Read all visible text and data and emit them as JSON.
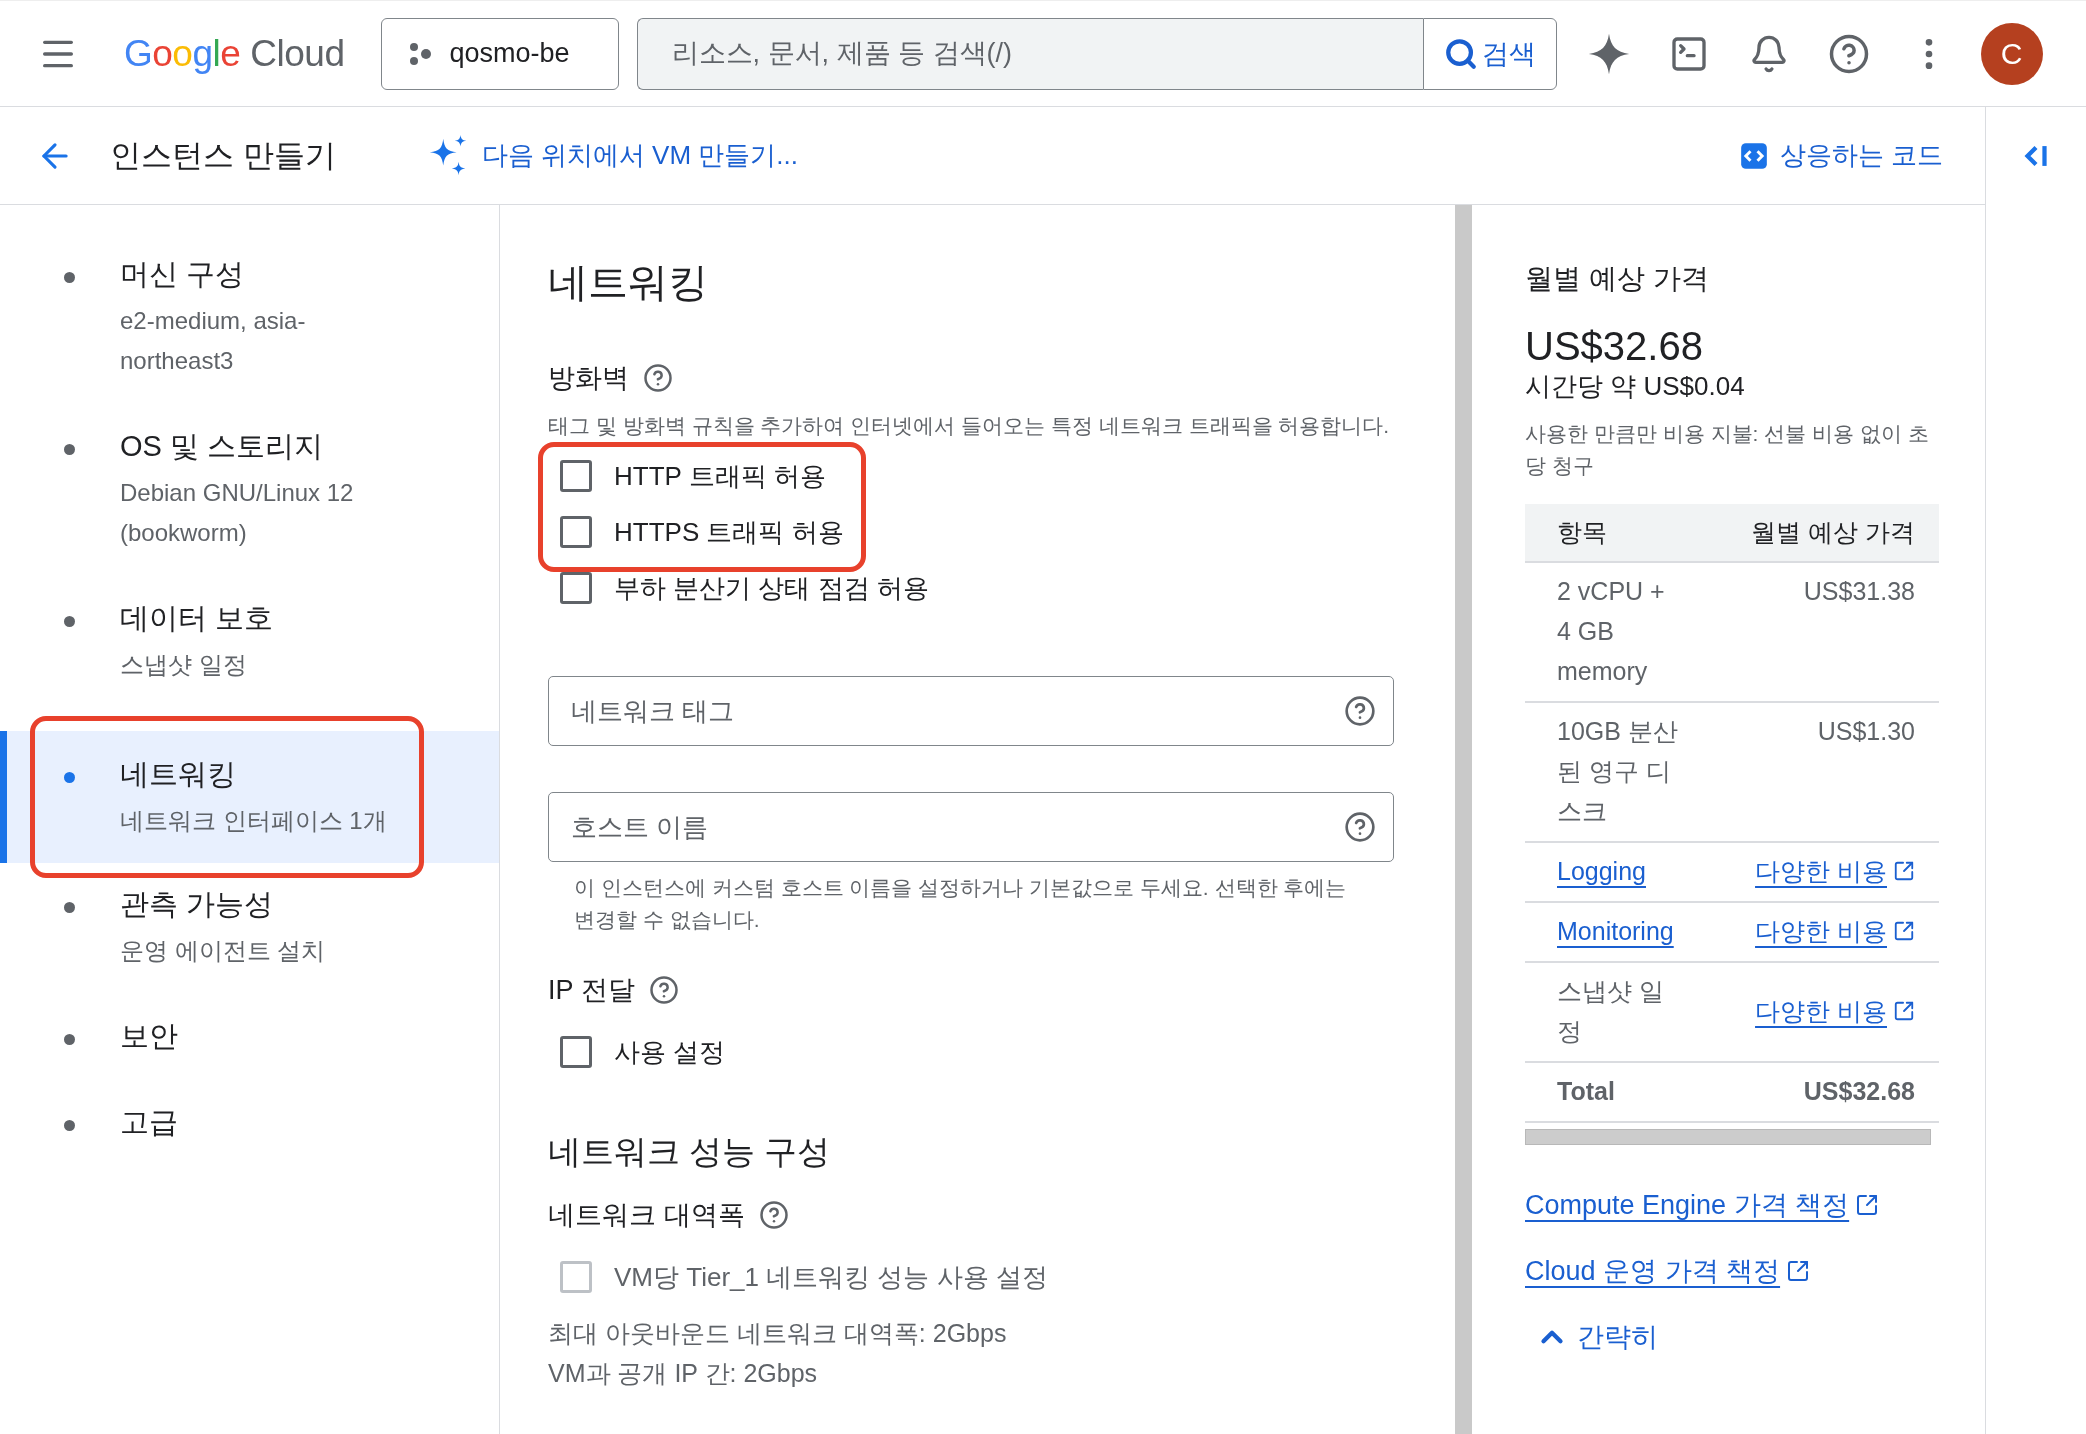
{
  "top_bar": {
    "logo": {
      "word_1": "Google",
      "word_2": "Cloud"
    },
    "project": "qosmo-be",
    "search": {
      "placeholder": "리소스, 문서, 제품 등 검색(/)",
      "button": "검색"
    },
    "avatar": "C"
  },
  "page_header": {
    "title": "인스턴스 만들기",
    "ai_link": "다음 위치에서 VM 만들기...",
    "code_link": "상응하는 코드"
  },
  "sidebar": {
    "items": [
      {
        "title": "머신 구성",
        "subtitle": "e2-medium, asia-northeast3",
        "selected": false,
        "highlighted": false
      },
      {
        "title": "OS 및 스토리지",
        "subtitle": "Debian GNU/Linux 12 (bookworm)",
        "selected": false,
        "highlighted": false
      },
      {
        "title": "데이터 보호",
        "subtitle": "스냅샷 일정",
        "selected": false,
        "highlighted": false
      },
      {
        "title": "네트워킹",
        "subtitle": "네트워크 인터페이스 1개",
        "selected": true,
        "highlighted": true
      },
      {
        "title": "관측 가능성",
        "subtitle": "운영 에이전트 설치",
        "selected": false,
        "highlighted": false
      },
      {
        "title": "보안",
        "selected": false,
        "highlighted": false
      },
      {
        "title": "고급",
        "selected": false,
        "highlighted": false
      }
    ]
  },
  "form": {
    "title": "네트워킹",
    "firewall": {
      "label": "방화벽",
      "description": "태그 및 방화벽 규칙을 추가하여 인터넷에서 들어오는 특정 네트워크 트래픽을 허용합니다.",
      "options": [
        {
          "label": "HTTP 트래픽 허용",
          "checked": false,
          "highlighted": true
        },
        {
          "label": "HTTPS 트래픽 허용",
          "checked": false,
          "highlighted": true
        },
        {
          "label": "부하 분산기 상태 점검 허용",
          "checked": false,
          "highlighted": false
        }
      ]
    },
    "network_tags": {
      "placeholder": "네트워크 태그"
    },
    "hostname": {
      "placeholder": "호스트 이름",
      "helper": "이 인스턴스에 커스텀 호스트 이름을 설정하거나 기본값으로 두세요. 선택한 후에는 변경할 수 없습니다."
    },
    "ip_forwarding": {
      "label": "IP 전달",
      "options": [
        {
          "label": "사용 설정",
          "checked": false
        }
      ]
    },
    "performance": {
      "title": "네트워크 성능 구성",
      "bandwidth_label": "네트워크 대역폭",
      "options": [
        {
          "label": "VM당 Tier_1 네트워킹 성능 사용 설정",
          "checked": false,
          "disabled": true
        }
      ],
      "info": [
        "최대 아웃바운드 네트워크 대역폭: 2Gbps",
        "VM과 공개 IP 간: 2Gbps"
      ]
    }
  },
  "pricing": {
    "title": "월별 예상 가격",
    "total": "US$32.68",
    "hourly": "시간당 약 US$0.04",
    "note": "사용한 만큼만 비용 지불: 선불 비용 없이 초당 청구",
    "columns": [
      "항목",
      "월별 예상 가격"
    ],
    "rows": [
      {
        "kind": "plain",
        "item": "2 vCPU + 4 GB memory",
        "price": "US$31.38"
      },
      {
        "kind": "plain",
        "item": "10GB 분산된 영구 디스크",
        "price": "US$1.30"
      },
      {
        "kind": "links",
        "item": "Logging",
        "price": "다양한 비용"
      },
      {
        "kind": "links",
        "item": "Monitoring",
        "price": "다양한 비용"
      },
      {
        "kind": "price_link",
        "item": "스냅샷 일정",
        "price": "다양한 비용"
      },
      {
        "kind": "total",
        "item": "Total",
        "price": "US$32.68"
      }
    ],
    "links": [
      "Compute Engine 가격 책정",
      "Cloud 운영 가격 책정"
    ],
    "collapse": "간략히"
  }
}
